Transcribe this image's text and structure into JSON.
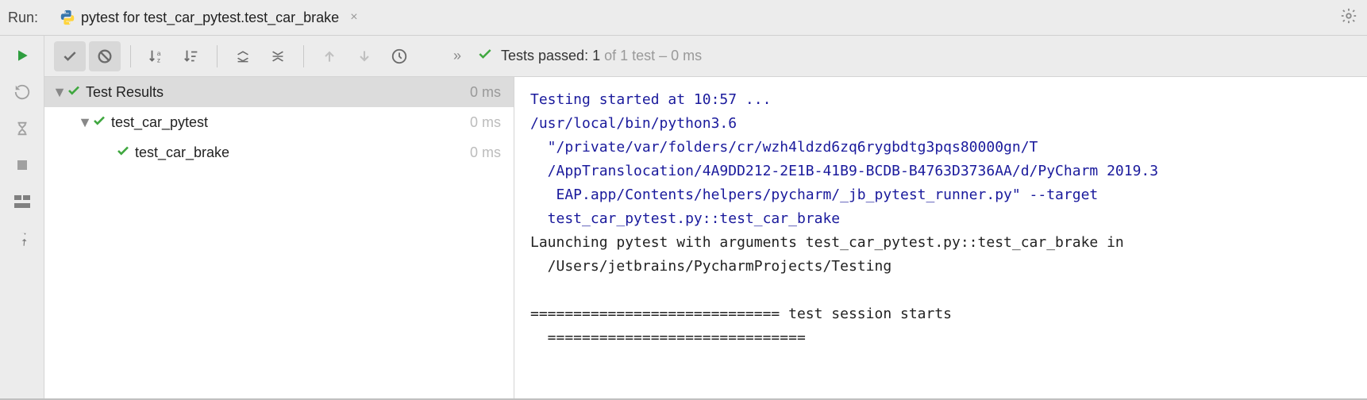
{
  "header": {
    "run_label": "Run:",
    "tab_title": "pytest for test_car_pytest.test_car_brake"
  },
  "toolbar": {
    "tests_passed_prefix": "Tests passed: ",
    "tests_passed_count": "1",
    "tests_passed_of": " of 1 test – ",
    "tests_passed_time": "0 ms",
    "chevrons": "»"
  },
  "tree": {
    "root": {
      "name": "Test Results",
      "time": "0 ms"
    },
    "suite": {
      "name": "test_car_pytest",
      "time": "0 ms"
    },
    "test": {
      "name": "test_car_brake",
      "time": "0 ms"
    }
  },
  "console": {
    "l1": "Testing started at 10:57 ...",
    "l2": "/usr/local/bin/python3.6",
    "l3": "  \"/private/var/folders/cr/wzh4ldzd6zq6rygbdtg3pqs80000gn/T",
    "l4": "  /AppTranslocation/4A9DD212-2E1B-41B9-BCDB-B4763D3736AA/d/PyCharm 2019.3",
    "l5": "   EAP.app/Contents/helpers/pycharm/_jb_pytest_runner.py\" --target",
    "l6": "  test_car_pytest.py::test_car_brake",
    "l7": "Launching pytest with arguments test_car_pytest.py::test_car_brake in",
    "l8": "  /Users/jetbrains/PycharmProjects/Testing",
    "l9": "",
    "l10": "============================= test session starts",
    "l11": "  =============================="
  }
}
